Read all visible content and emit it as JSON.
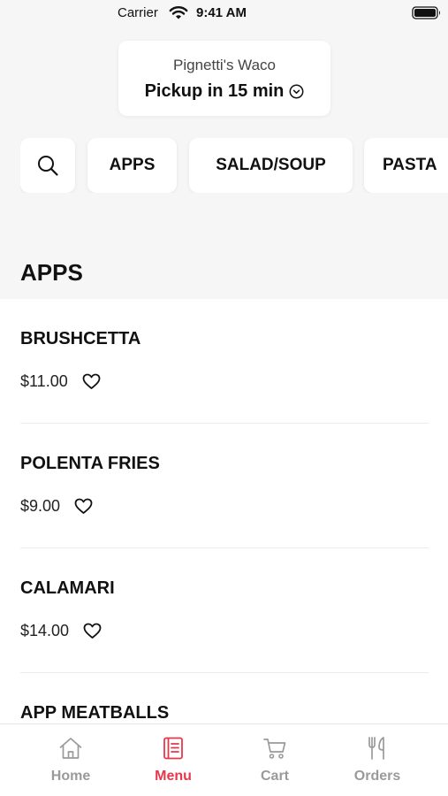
{
  "status_bar": {
    "carrier": "Carrier",
    "time": "9:41 AM"
  },
  "location": {
    "store": "Pignetti's Waco",
    "pickup": "Pickup in 15 min"
  },
  "categories": [
    "APPS",
    "SALAD/SOUP",
    "PASTA"
  ],
  "section_title": "APPS",
  "items": [
    {
      "name": "BRUSHCETTA",
      "price": "$11.00"
    },
    {
      "name": "POLENTA FRIES",
      "price": "$9.00"
    },
    {
      "name": "CALAMARI",
      "price": "$14.00"
    },
    {
      "name": "APP MEATBALLS",
      "price": ""
    }
  ],
  "tabs": {
    "home": "Home",
    "menu": "Menu",
    "cart": "Cart",
    "orders": "Orders"
  },
  "colors": {
    "accent": "#e8374b",
    "inactive": "#9a9a9a",
    "background": "#f6f6f6"
  }
}
